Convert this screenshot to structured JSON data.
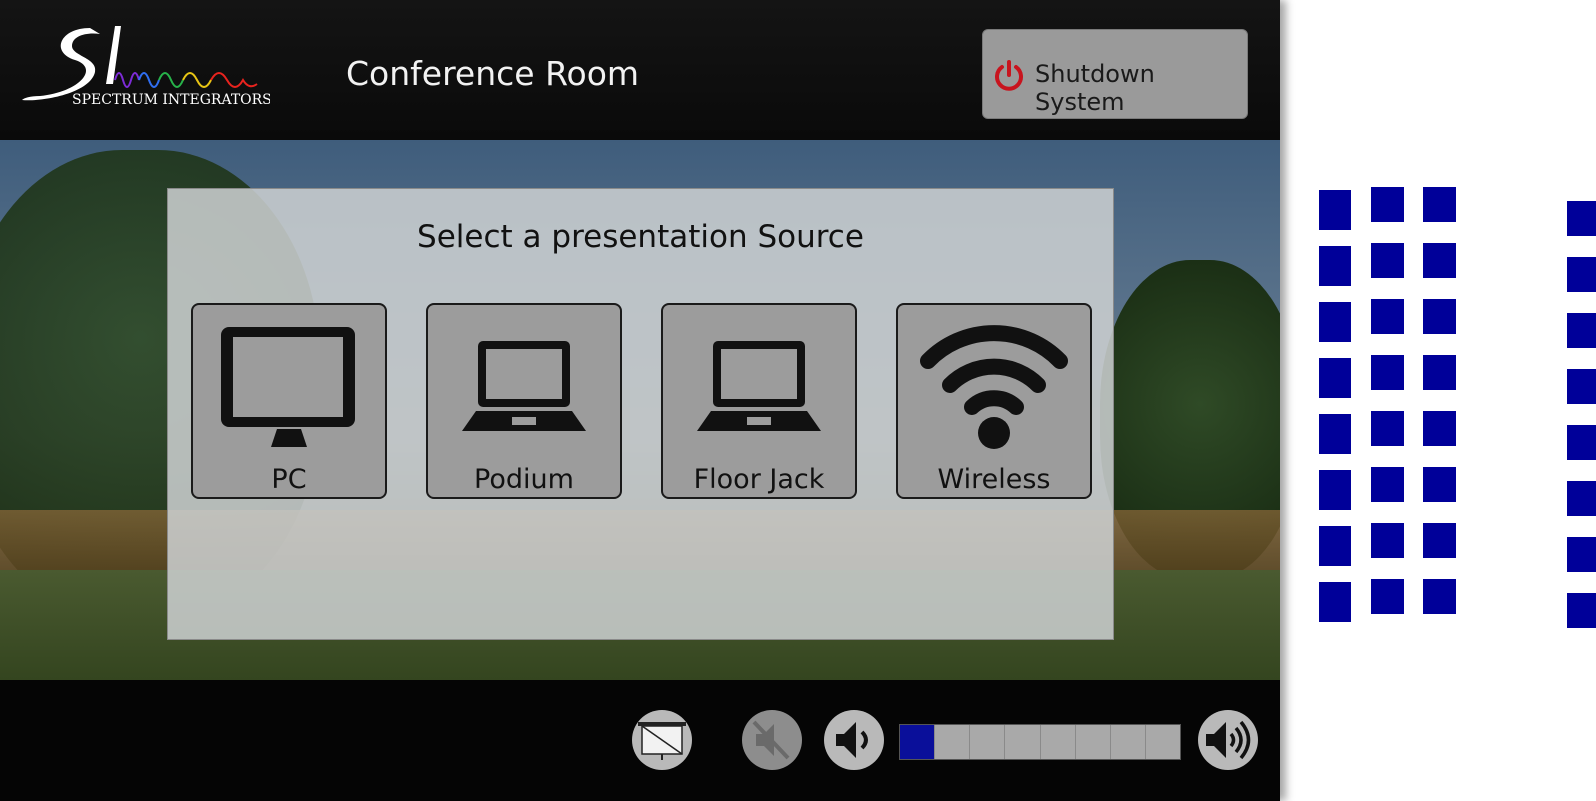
{
  "header": {
    "logo_text": "SPECTRUM INTEGRATORS",
    "room_title": "Conference Room",
    "shutdown_label": "Shutdown System",
    "shutdown_icon": "power-icon"
  },
  "sources": {
    "title": "Select a presentation Source",
    "items": [
      {
        "label": "PC",
        "icon": "monitor-icon"
      },
      {
        "label": "Podium",
        "icon": "laptop-icon"
      },
      {
        "label": "Floor Jack",
        "icon": "laptop-icon"
      },
      {
        "label": "Wireless",
        "icon": "wifi-icon"
      }
    ]
  },
  "footer": {
    "screen_icon": "projector-screen-icon",
    "mute_icon": "speaker-mute-icon",
    "vol_down_icon": "volume-down-icon",
    "vol_up_icon": "volume-up-icon",
    "volume_level": 1,
    "volume_segments": 8
  },
  "colors": {
    "accent": "#0a0f9a",
    "power_red": "#c8141e",
    "panel_bg": "#000000",
    "button_gray": "#9c9c9c",
    "side_squares": "#000099"
  }
}
